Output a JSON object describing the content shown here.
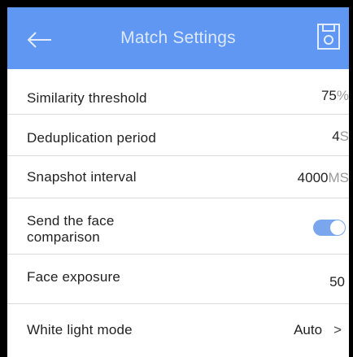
{
  "header": {
    "title": "Match Settings",
    "back_icon": "arrow-left-icon",
    "save_icon": "floppy-disk-icon",
    "background_color": "#5f97f2"
  },
  "settings": [
    {
      "label": "Similarity threshold",
      "value": "75",
      "unit": "%"
    },
    {
      "label": "Deduplication period",
      "value": "4",
      "unit": "S"
    },
    {
      "label": "Snapshot interval",
      "value": "4000",
      "unit": "MS"
    },
    {
      "label": "Send the face comparison",
      "toggle": "on"
    },
    {
      "label": "Face exposure",
      "value": "50"
    },
    {
      "label": "White light mode",
      "value": "Auto",
      "chevron": ">"
    }
  ],
  "colors": {
    "toggle_on": "#7aa6ee",
    "unit_text": "#9a9a9a"
  }
}
